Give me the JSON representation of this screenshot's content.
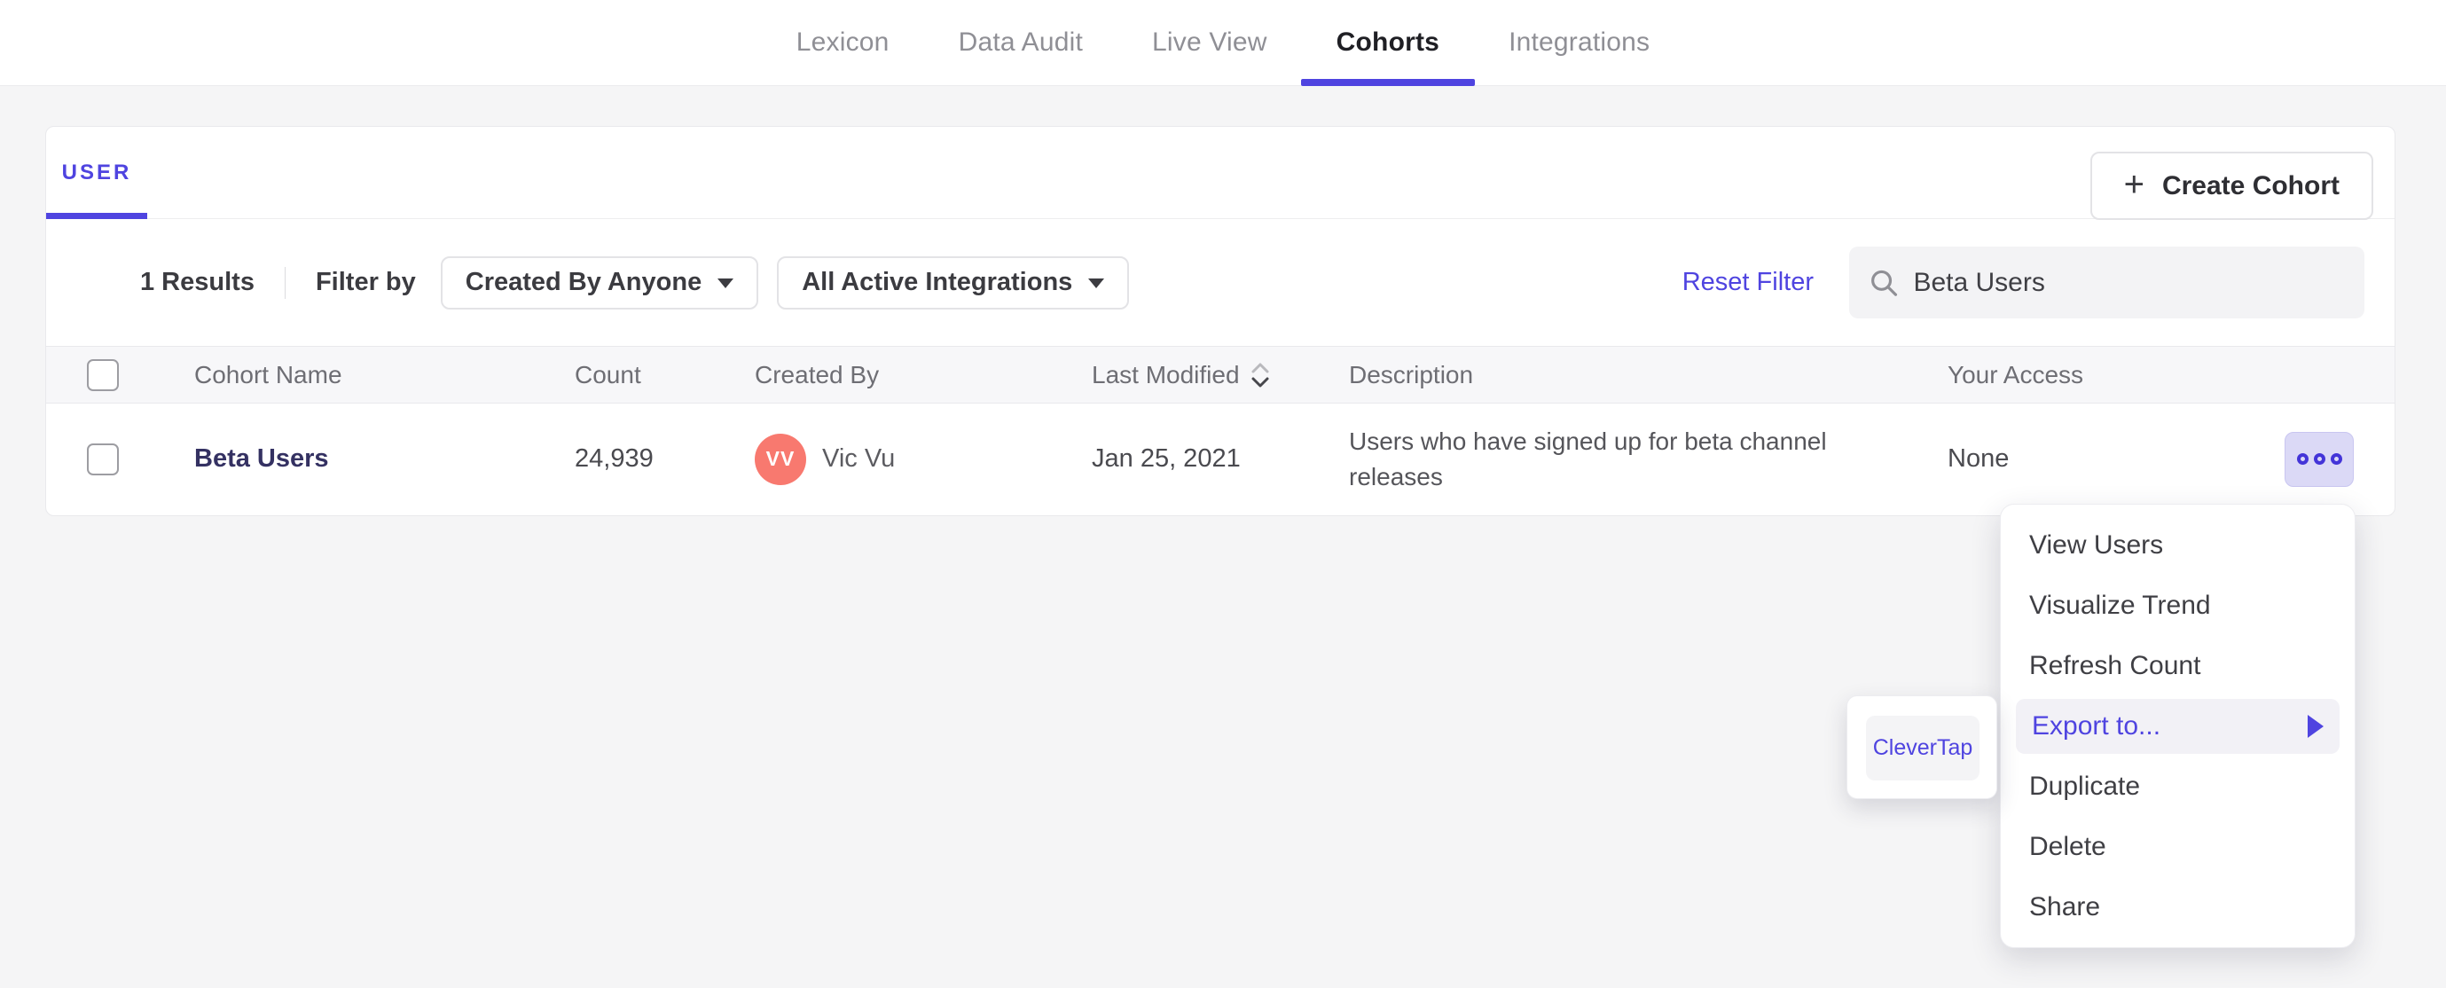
{
  "nav": {
    "tabs": [
      {
        "label": "Lexicon",
        "active": false
      },
      {
        "label": "Data Audit",
        "active": false
      },
      {
        "label": "Live View",
        "active": false
      },
      {
        "label": "Cohorts",
        "active": true
      },
      {
        "label": "Integrations",
        "active": false
      }
    ]
  },
  "cohorts_card": {
    "user_tab_label": "USER",
    "create_button": {
      "plus": "+",
      "label": "Create Cohort"
    },
    "filters": {
      "results_count": "1 Results",
      "filter_by_label": "Filter by",
      "created_by_dropdown": "Created By Anyone",
      "integrations_dropdown": "All Active Integrations",
      "reset_label": "Reset Filter",
      "search_value": "Beta Users"
    },
    "table": {
      "headers": {
        "cohort_name": "Cohort Name",
        "count": "Count",
        "created_by": "Created By",
        "last_modified": "Last Modified",
        "description": "Description",
        "your_access": "Your Access"
      },
      "row": {
        "cohort_name": "Beta Users",
        "count": "24,939",
        "avatar_initials": "VV",
        "created_by": "Vic Vu",
        "last_modified": "Jan 25, 2021",
        "description": "Users who have signed up for beta channel releases",
        "your_access": "None"
      }
    }
  },
  "context_menu": {
    "items": [
      "View Users",
      "Visualize Trend",
      "Refresh Count",
      "Export to...",
      "Duplicate",
      "Delete",
      "Share"
    ],
    "submenu": {
      "item": "CleverTap"
    }
  },
  "colors": {
    "accent_purple": "#4f44e0",
    "avatar_salmon": "#f8796f",
    "cohort_link_navy": "#343162",
    "actions_button_lavender": "#dbd9f6",
    "page_background": "#f5f5f6"
  }
}
